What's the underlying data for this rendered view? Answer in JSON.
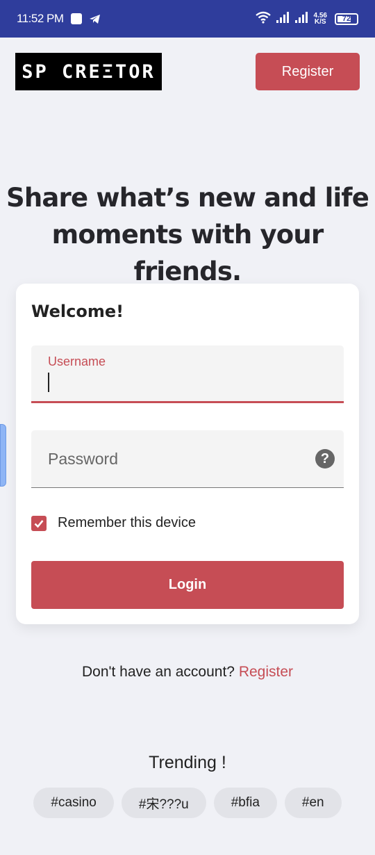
{
  "status_bar": {
    "time": "11:52 PM",
    "net_speed_value": "4.56",
    "net_speed_unit": "K/S",
    "battery": "72",
    "battery_level": 0.72
  },
  "header": {
    "logo_text": "SP CREΞTOR",
    "register_label": "Register"
  },
  "tagline": {
    "line1": "Share what’s new and life",
    "line2": "moments with your friends."
  },
  "login_card": {
    "welcome": "Welcome!",
    "username_label": "Username",
    "password_placeholder": "Password",
    "help_icon": "?",
    "remember_label": "Remember this device",
    "remember_checked": true,
    "login_label": "Login"
  },
  "signup": {
    "prompt": "Don't have an account?",
    "link": "Register"
  },
  "trending": {
    "title": "Trending !",
    "tags": [
      "#casino",
      "#宋???u",
      "#bfia",
      "#en"
    ]
  },
  "colors": {
    "accent": "#c64d55",
    "status_bar": "#2f3d9c",
    "background": "#f0f1f6"
  },
  "icons": {
    "status_left": [
      "square-notification-icon",
      "telegram-icon"
    ],
    "status_right": [
      "wifi-icon",
      "signal-icon",
      "signal-icon-2",
      "battery-icon"
    ],
    "password": "help-icon",
    "remember": "check-icon"
  }
}
